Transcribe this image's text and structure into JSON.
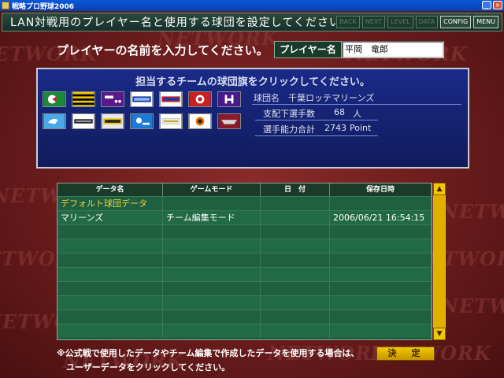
{
  "window": {
    "title": "戦略プロ野球2006"
  },
  "watermark": "NETWORK",
  "header": {
    "title": "LAN対戦用のプレイヤー名と使用する球団を設定してください。",
    "buttons": [
      {
        "label": "BACK",
        "enabled": false
      },
      {
        "label": "NEXT",
        "enabled": false
      },
      {
        "label": "LEVEL",
        "enabled": false
      },
      {
        "label": "DATA",
        "enabled": false
      },
      {
        "label": "CONFIG",
        "enabled": true
      },
      {
        "label": "MENU",
        "enabled": true
      }
    ]
  },
  "player": {
    "prompt": "プレイヤーの名前を入力してください。",
    "label": "プレイヤー名",
    "value": "平岡　竜郎"
  },
  "team_panel": {
    "title": "担当するチームの球団旗をクリックしてください。",
    "team_name_label": "球団名",
    "team_name_value": "千葉ロッテマリーンズ",
    "players_label": "支配下選手数",
    "players_value": "68",
    "players_unit": "人",
    "ability_label": "選手能力合計",
    "ability_value": "2743",
    "ability_unit": "Point"
  },
  "table": {
    "columns": [
      "データ名",
      "ゲームモード",
      "日　付",
      "保存日時"
    ],
    "rows": [
      {
        "name": "デフォルト球団データ",
        "mode": "",
        "date": "",
        "saved": ""
      },
      {
        "name": "マリーンズ",
        "mode": "チーム編集モード",
        "date": "",
        "saved": "2006/06/21 16:54:15"
      },
      {
        "name": "",
        "mode": "",
        "date": "",
        "saved": ""
      },
      {
        "name": "",
        "mode": "",
        "date": "",
        "saved": ""
      },
      {
        "name": "",
        "mode": "",
        "date": "",
        "saved": ""
      },
      {
        "name": "",
        "mode": "",
        "date": "",
        "saved": ""
      },
      {
        "name": "",
        "mode": "",
        "date": "",
        "saved": ""
      },
      {
        "name": "",
        "mode": "",
        "date": "",
        "saved": ""
      },
      {
        "name": "",
        "mode": "",
        "date": "",
        "saved": ""
      },
      {
        "name": "",
        "mode": "",
        "date": "",
        "saved": ""
      }
    ]
  },
  "note": {
    "line1": "※公式戦で使用したデータやチーム編集で作成したデータを使用する場合は、",
    "line2": "ユーザーデータをクリックしてください。"
  },
  "decide_label": "決　定",
  "colors": {
    "accent": "#f0c800",
    "panel": "#1a2a88",
    "table": "#1a5a3a"
  }
}
